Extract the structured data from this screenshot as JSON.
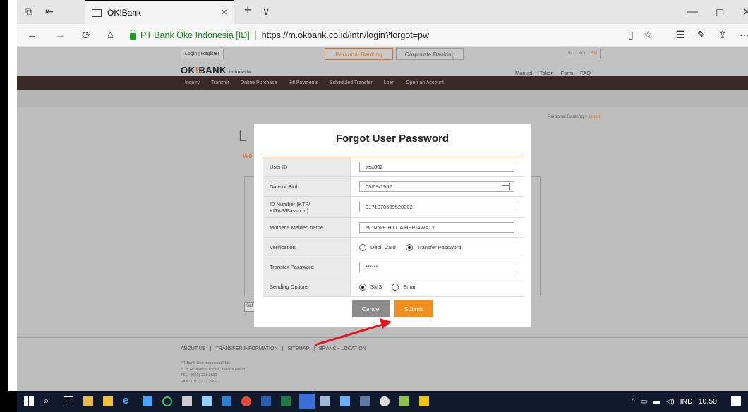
{
  "browser": {
    "tab_title": "OK!Bank",
    "tab_close": "×",
    "new_tab": "+",
    "tab_menu": "∨",
    "back": "←",
    "forward": "→",
    "refresh": "⟳",
    "home": "⌂",
    "cert_label": "PT Bank Oke Indonesia [ID]",
    "url": "https://m.okbank.co.id/intn/login?forgot=pw",
    "more": "···",
    "minimize": "—",
    "maximize": "◻",
    "close": "✕"
  },
  "header": {
    "login_register": "Login | Register",
    "personal_banking": "Personal Banking",
    "corporate_banking": "Corporate Banking",
    "languages": [
      "IN",
      "KO",
      "EN"
    ],
    "active_language": "EN",
    "logo_main": "OK",
    "logo_mark": "!",
    "logo_rest": "BANK",
    "logo_sub": "Indonesia",
    "top_links": [
      "Manual",
      "Token",
      "Form",
      "FAQ"
    ],
    "menu": [
      "Inquiry",
      "Transfer",
      "Online Purchase",
      "Bill Payments",
      "Scheduled Transfer",
      "Loan",
      "Open an Account"
    ]
  },
  "page": {
    "breadcrumb_root": "Personal Banking",
    "breadcrumb_sep": " > ",
    "breadcrumb_current": "Login",
    "heading_fragment": "L",
    "welcome_fragment": "We",
    "safe_fragment": "Saf"
  },
  "footer": {
    "links": [
      "ABOUT US",
      "TRANSFER INFORMATION",
      "SITEMAP",
      "BRANCH LOCATION"
    ],
    "company": "PT Bank Oke Indonesia Tbk.",
    "address": "Jl. Ir. H. Juanda No 12, Jakarta Pusat",
    "tel": "TEL : (021) 231 2633",
    "fax": "FAX : (021) 231 2604"
  },
  "modal": {
    "title": "Forgot User Password",
    "fields": [
      {
        "label": "User ID",
        "value": "test002"
      },
      {
        "label": "Date of Birth",
        "value": "05/09/1952"
      },
      {
        "label": "ID Number (KTP/ KITAS/Passport)",
        "value": "3171070509520002"
      },
      {
        "label": "Mother's Maiden name",
        "value": "NONNIE HILDA HERIAWATY"
      },
      {
        "label": "Verification",
        "options": [
          "Debit Card",
          "Transfer Password"
        ],
        "selected": "Transfer Password"
      },
      {
        "label": "Transfer Password",
        "value": "******"
      },
      {
        "label": "Sending Options",
        "options": [
          "SMS",
          "Email"
        ],
        "selected": "SMS"
      }
    ],
    "cancel_label": "Cancel",
    "submit_label": "Submit"
  },
  "taskbar": {
    "language": "IND",
    "time": "10.50"
  },
  "colors": {
    "accent": "#f28e1c",
    "menu_bar": "#3a2a25",
    "arrow": "#e8141b"
  }
}
